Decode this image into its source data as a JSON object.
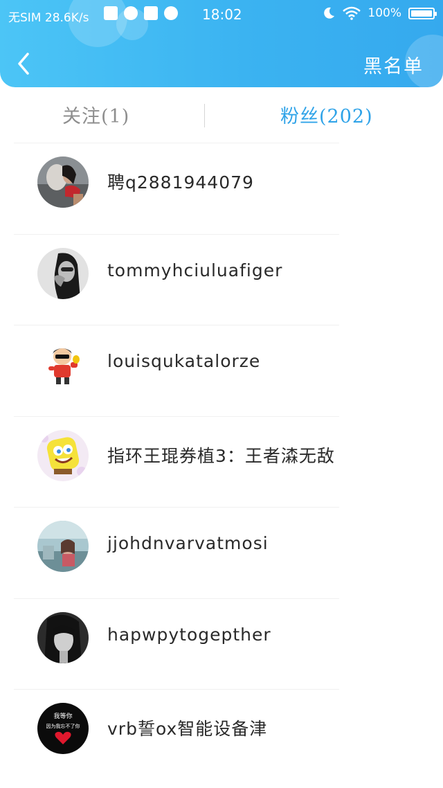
{
  "status_bar": {
    "carrier": "无SIM",
    "speed": "28.6K/s",
    "time": "18:02",
    "battery": "100%"
  },
  "header": {
    "back_icon": "chevron-left-icon",
    "blacklist_label": "黑名单",
    "gradient_start": "#4cc5f6",
    "gradient_end": "#35a9ee"
  },
  "tabs": [
    {
      "label": "关注(1)",
      "active": false
    },
    {
      "label": "粉丝(202)",
      "active": true
    }
  ],
  "accent_color": "#2fa3e8",
  "users": [
    {
      "name": "聘q2881944079",
      "avatar": "woman-photo-avatar"
    },
    {
      "name": "tommyhciuluafiger",
      "avatar": "bw-portrait-avatar"
    },
    {
      "name": "louisqukatalorze",
      "avatar": "cartoon-boy-avatar"
    },
    {
      "name": "指环王琨券植3：王者潹无敌",
      "avatar": "spongebob-avatar"
    },
    {
      "name": "jjohdnvarvatmosi",
      "avatar": "girl-photo-avatar"
    },
    {
      "name": "hapwpytogepther",
      "avatar": "bw-woman-avatar"
    },
    {
      "name": "vrb誓ox智能设备津",
      "avatar": "heart-text-avatar",
      "avatar_text_1": "我等你",
      "avatar_text_2": "因为我忘不了你"
    }
  ]
}
